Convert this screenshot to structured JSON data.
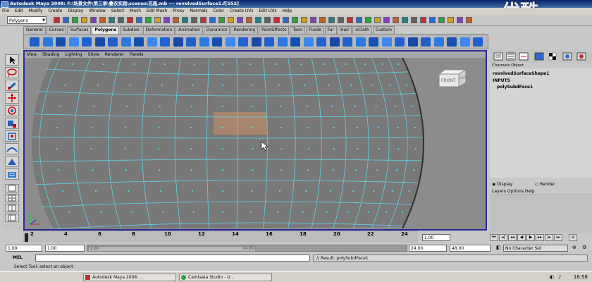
{
  "window": {
    "title": "Autodesk Maya 2008: F:\\场景文件\\第三章\\叠衣实践\\scenes\\花瓶.mb   ---   revolvedSurface1.f[552]"
  },
  "watermark": "优酷",
  "menubar": [
    "File",
    "Edit",
    "Modify",
    "Create",
    "Display",
    "Window",
    "Select",
    "Mesh",
    "Edit Mesh",
    "Proxy",
    "Normals",
    "Color",
    "Create UVs",
    "Edit UVs",
    "Help"
  ],
  "statusline": {
    "mode": "Polygons"
  },
  "shelf_tabs": [
    "General",
    "Curves",
    "Surfaces",
    "Polygons",
    "Subdivs",
    "Deformation",
    "Animation",
    "Dynamics",
    "Rendering",
    "PaintEffects",
    "Toon",
    "Fluids",
    "Fur",
    "Hair",
    "nCloth",
    "Custom"
  ],
  "shelf_active_tab": "Polygons",
  "panel_menu": [
    "View",
    "Shading",
    "Lighting",
    "Show",
    "Renderer",
    "Panels"
  ],
  "viewcube": {
    "front": "FRONT",
    "side": "LEFT"
  },
  "viewport": {
    "mesh_color": "#787878",
    "wire_color": "#5fd6e8",
    "selection_color": "#b88a6a"
  },
  "channel_box": {
    "header": [
      "Channels",
      "Object"
    ],
    "object_name": "revolvedSurfaceShape1",
    "inputs_label": "INPUTS",
    "input_node": "polySubdFace1"
  },
  "layer_editor": {
    "display_label": "Display",
    "render_label": "Render",
    "menu": [
      "Layers",
      "Options",
      "Help"
    ]
  },
  "time_slider": {
    "ticks": [
      "2",
      "4",
      "6",
      "8",
      "10",
      "12",
      "14",
      "16",
      "18",
      "20",
      "22",
      "24"
    ]
  },
  "playback": {
    "current_frame": "1.00"
  },
  "range_slider": {
    "start_time": "1.00",
    "start_range": "1.00",
    "thumb_start": "1.00",
    "thumb_end": "24.00",
    "end_range": "24.00",
    "end_time": "48.00",
    "character_set": "No Character Set"
  },
  "command_line": {
    "label": "MEL",
    "result": "// Result: polySubdFace1"
  },
  "help_line": "Select Tool: select an object",
  "taskbar": {
    "tasks": [
      "Autodesk Maya 2008: ...",
      "Camtasia Studio - U..."
    ],
    "clock": "16:58"
  }
}
